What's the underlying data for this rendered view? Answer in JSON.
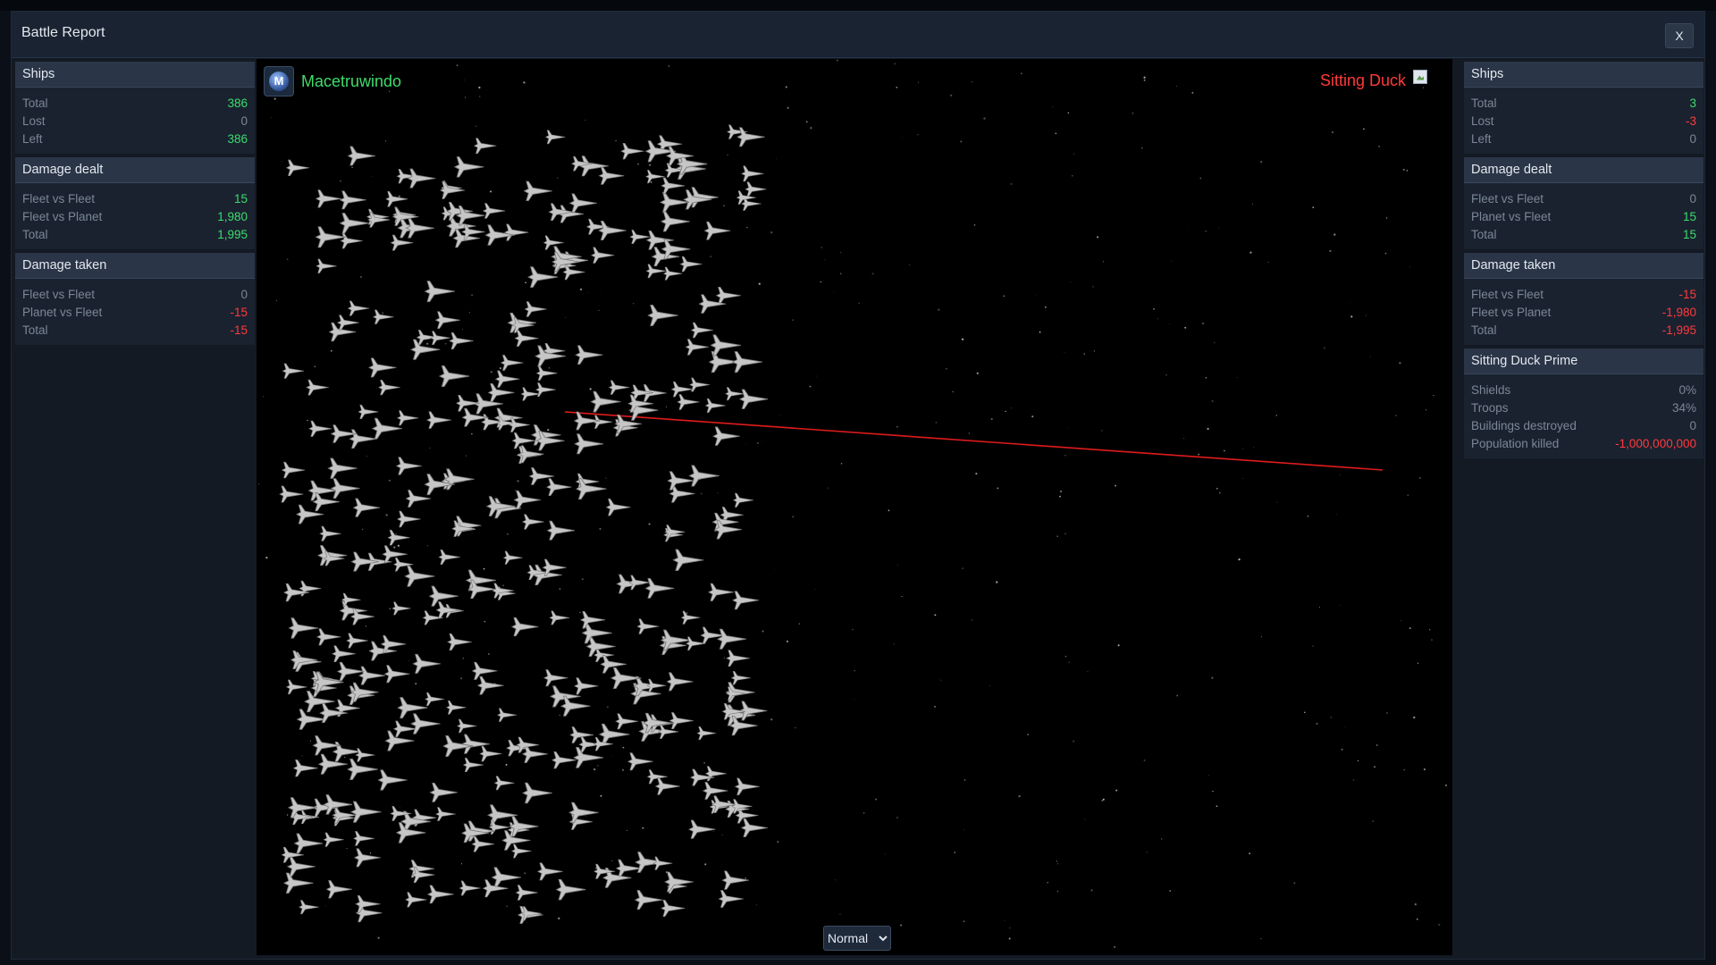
{
  "dialog": {
    "title": "Battle Report",
    "close_label": "X"
  },
  "left": {
    "player_name": "Macetruwindo",
    "emblem_letter": "M",
    "ships": {
      "header": "Ships",
      "rows": [
        {
          "label": "Total",
          "value": "386",
          "tone": "g"
        },
        {
          "label": "Lost",
          "value": "0",
          "tone": "n"
        },
        {
          "label": "Left",
          "value": "386",
          "tone": "g"
        }
      ]
    },
    "dealt": {
      "header": "Damage dealt",
      "rows": [
        {
          "label": "Fleet vs Fleet",
          "value": "15",
          "tone": "g"
        },
        {
          "label": "Fleet vs Planet",
          "value": "1,980",
          "tone": "g"
        },
        {
          "label": "Total",
          "value": "1,995",
          "tone": "g"
        }
      ]
    },
    "taken": {
      "header": "Damage taken",
      "rows": [
        {
          "label": "Fleet vs Fleet",
          "value": "0",
          "tone": "n"
        },
        {
          "label": "Planet vs Fleet",
          "value": "-15",
          "tone": "r"
        },
        {
          "label": "Total",
          "value": "-15",
          "tone": "r"
        }
      ]
    }
  },
  "right": {
    "player_name": "Sitting Duck",
    "ships": {
      "header": "Ships",
      "rows": [
        {
          "label": "Total",
          "value": "3",
          "tone": "g"
        },
        {
          "label": "Lost",
          "value": "-3",
          "tone": "r"
        },
        {
          "label": "Left",
          "value": "0",
          "tone": "n"
        }
      ]
    },
    "dealt": {
      "header": "Damage dealt",
      "rows": [
        {
          "label": "Fleet vs Fleet",
          "value": "0",
          "tone": "n"
        },
        {
          "label": "Planet vs Fleet",
          "value": "15",
          "tone": "g"
        },
        {
          "label": "Total",
          "value": "15",
          "tone": "g"
        }
      ]
    },
    "taken": {
      "header": "Damage taken",
      "rows": [
        {
          "label": "Fleet vs Fleet",
          "value": "-15",
          "tone": "r"
        },
        {
          "label": "Fleet vs Planet",
          "value": "-1,980",
          "tone": "r"
        },
        {
          "label": "Total",
          "value": "-1,995",
          "tone": "r"
        }
      ]
    },
    "planet": {
      "header": "Sitting Duck Prime",
      "rows": [
        {
          "label": "Shields",
          "value": "0%",
          "tone": "n"
        },
        {
          "label": "Troops",
          "value": "34%",
          "tone": "n"
        },
        {
          "label": "Buildings destroyed",
          "value": "0",
          "tone": "n"
        },
        {
          "label": "Population killed",
          "value": "-1,000,000,000",
          "tone": "r"
        }
      ]
    }
  },
  "playback": {
    "speed_selected": "Normal",
    "options": [
      "Normal"
    ]
  },
  "colors": {
    "positive": "#3ddc6a",
    "negative": "#ff3a3a",
    "neutral": "#7b8796",
    "laser": "#e01b1b"
  },
  "icons": {
    "close": "close-icon",
    "emblem": "faction-emblem-icon",
    "broken_image": "broken-image-icon",
    "dropdown": "chevron-down-icon"
  }
}
